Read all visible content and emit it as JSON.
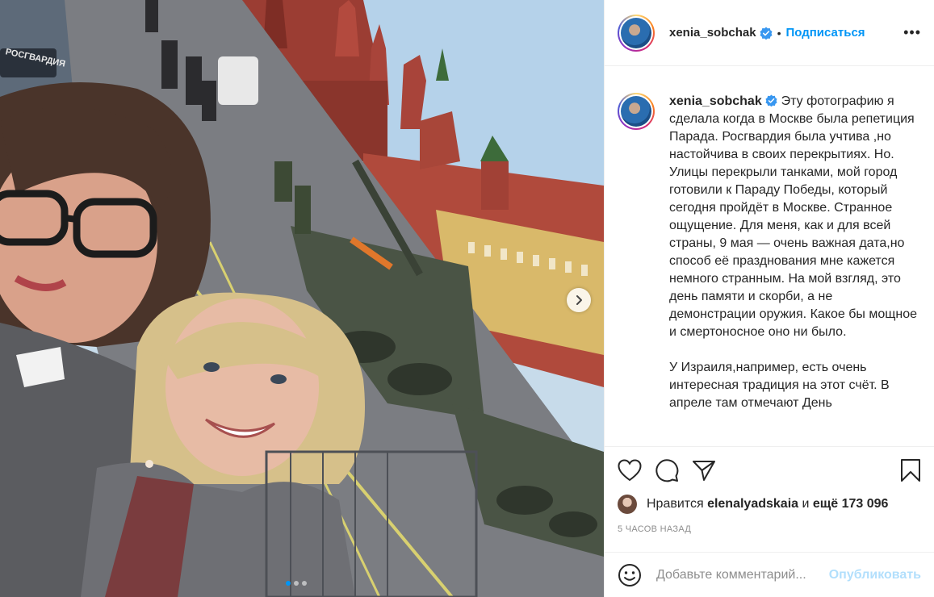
{
  "post": {
    "username": "xenia_sobchak",
    "separator": "•",
    "follow_label": "Подписаться",
    "more_label": "•••",
    "caption_username": "xenia_sobchak",
    "caption_paragraphs": [
      "Эту фотографию я сделала когда в Москве была репетиция Парада. Росгвардия была учтива ,но настойчива в своих перекрытиях. Но. Улицы перекрыли танками, мой город готовили к Параду Победы, который сегодня пройдёт в Москве. Странное ощущение. Для меня, как и для всей страны, 9 мая — очень важная дата,но способ её празднования мне кажется немного странным. На мой взгляд, это день памяти и скорби, а не демонстрации оружия. Какое бы мощное и смертоносное оно ни было.",
      "У Израиля,например, есть очень интересная традиция на этот счёт. В апреле там отмечают День"
    ],
    "likes": {
      "prefix": "Нравится",
      "liker": "elenalyadskaia",
      "middle": "и",
      "count": "ещё 173 096"
    },
    "time": "5 часов назад",
    "comment_placeholder": "Добавьте комментарий...",
    "publish_label": "Опубликовать",
    "photo_overlay_text": "РОСГВАРДИЯ",
    "carousel": {
      "total": 3,
      "active": 1
    }
  },
  "colors": {
    "accent": "#0095f6",
    "publish_disabled": "#b2dffc",
    "muted": "#8e8e8e",
    "border": "#efefef"
  },
  "icons": [
    "carousel-next-icon",
    "verified-badge-icon",
    "more-options-icon",
    "heart-icon",
    "comment-icon",
    "share-icon",
    "bookmark-icon",
    "emoji-icon"
  ]
}
